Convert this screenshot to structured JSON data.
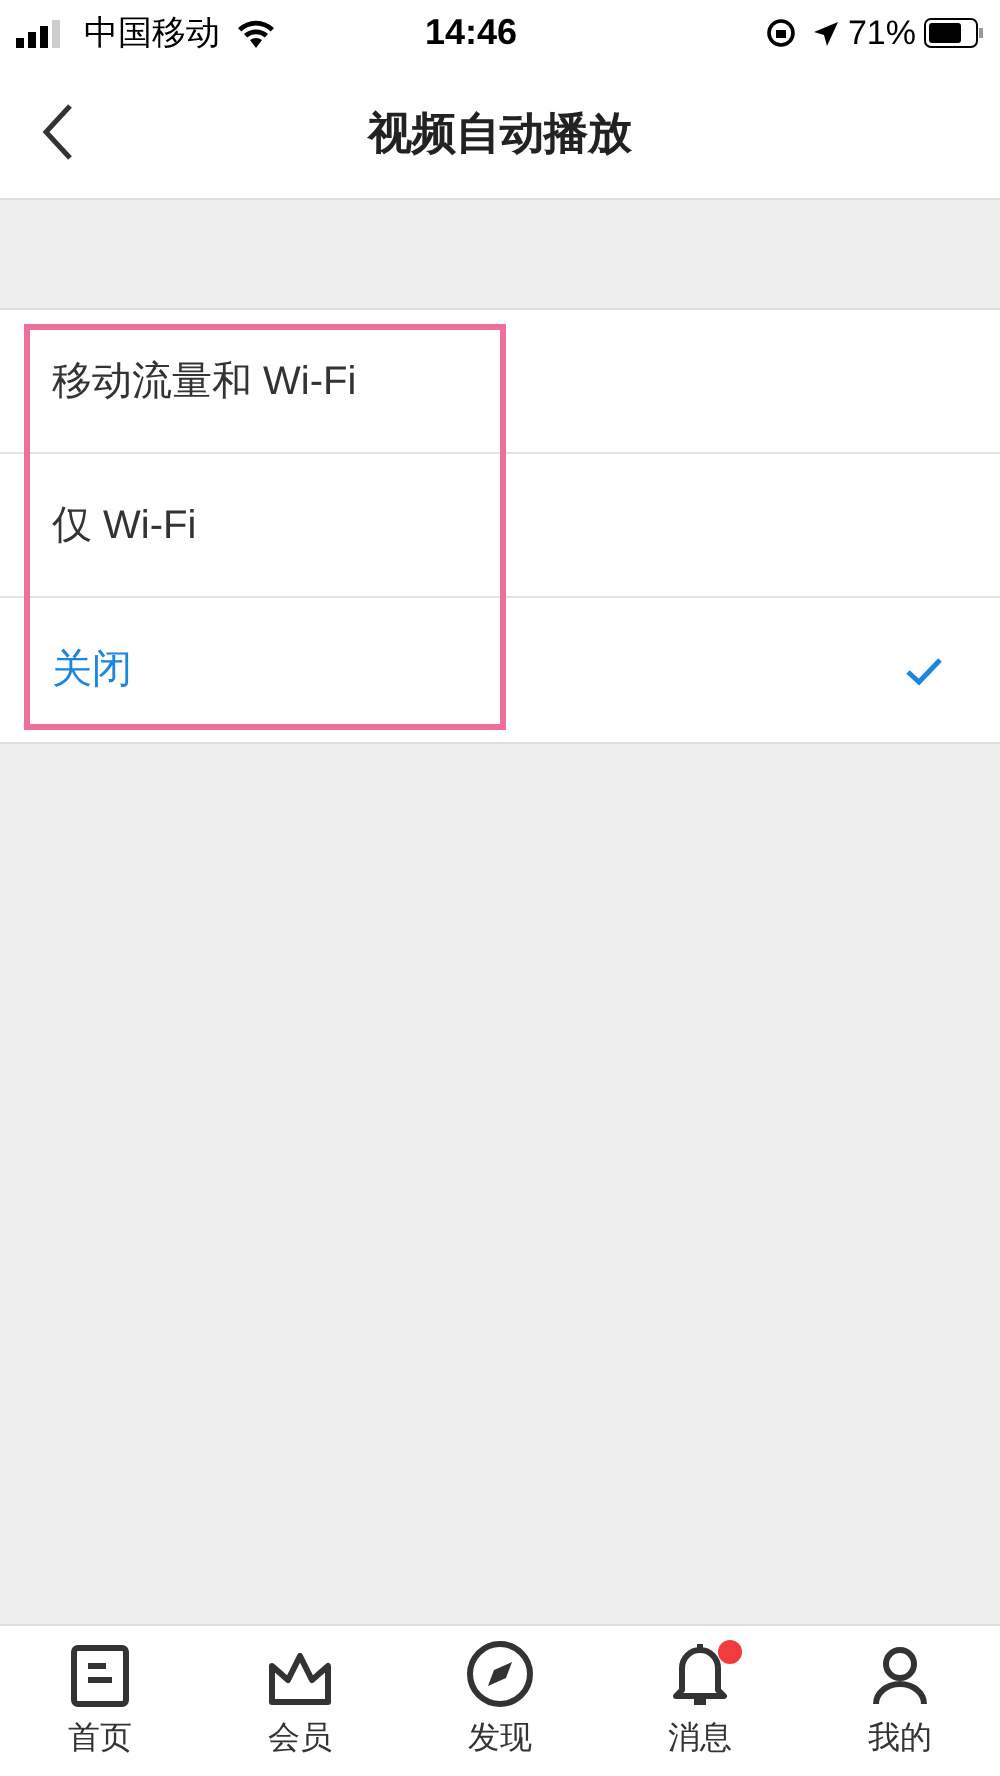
{
  "status_bar": {
    "carrier": "中国移动",
    "time": "14:46",
    "battery": "71%"
  },
  "nav": {
    "title": "视频自动播放"
  },
  "options": [
    {
      "label": "移动流量和 Wi-Fi",
      "selected": false
    },
    {
      "label": "仅 Wi-Fi",
      "selected": false
    },
    {
      "label": "关闭",
      "selected": true
    }
  ],
  "tab_bar": [
    {
      "kind": "home",
      "label": "首页",
      "badge": false
    },
    {
      "kind": "vip",
      "label": "会员",
      "badge": false
    },
    {
      "kind": "discover",
      "label": "发现",
      "badge": false
    },
    {
      "kind": "messages",
      "label": "消息",
      "badge": true
    },
    {
      "kind": "me",
      "label": "我的",
      "badge": false
    }
  ]
}
